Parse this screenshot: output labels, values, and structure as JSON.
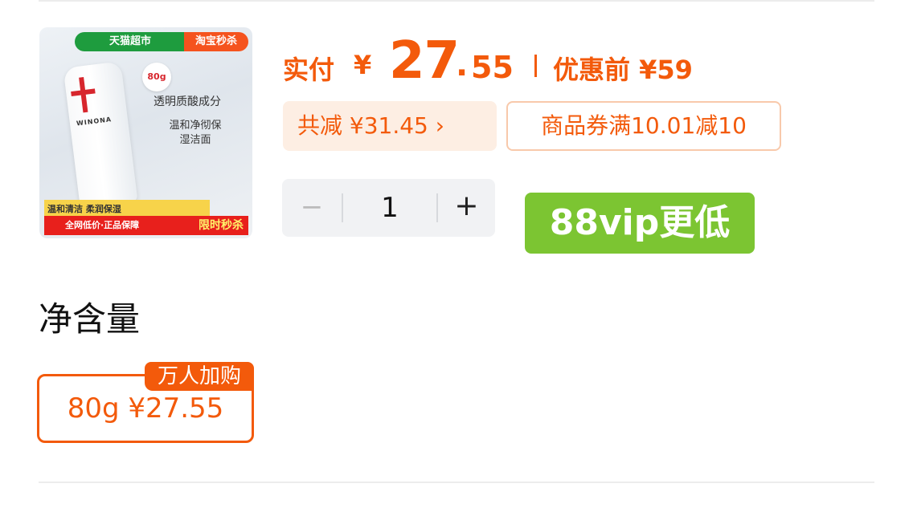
{
  "product": {
    "image": {
      "tag_left": "天猫超市",
      "tag_right": "淘宝秒杀",
      "brand": "WINONA",
      "size_badge": "80g",
      "copy_line1": "透明质酸成分",
      "copy_line2": "温和净彻保湿洁面",
      "bar_yellow": "温和清洁 柔润保湿",
      "bar_red": "全网低价·正品保障",
      "bar_red_flash": "限时秒杀"
    },
    "price": {
      "label": "实付",
      "currency": "¥",
      "integer": "27",
      "dot": ".",
      "decimal": "55",
      "original": "优惠前 ¥59"
    },
    "saving_chip": "共减 ¥31.45 ›",
    "coupon_chip": "商品券满10.01减10",
    "quantity": {
      "minus": "−",
      "value": "1",
      "plus": "+"
    },
    "vip_badge": "88vip更低"
  },
  "spec": {
    "title": "净含量",
    "option_label": "80g  ¥27.55",
    "option_tag": "万人加购"
  },
  "colors": {
    "accent": "#f35a0b",
    "vip_green": "#7cc532",
    "chip_bg": "#fdeee3"
  }
}
